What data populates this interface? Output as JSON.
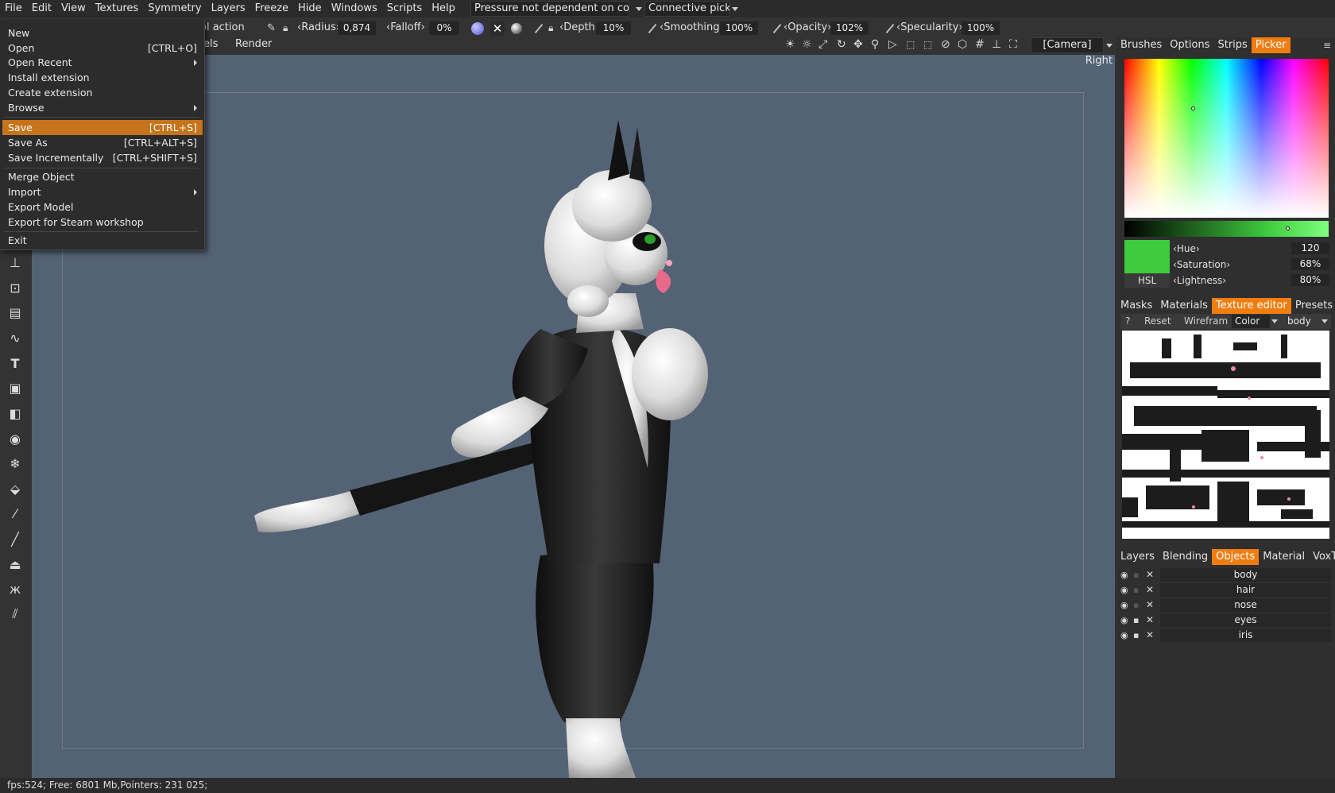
{
  "menubar": {
    "items": [
      "File",
      "Edit",
      "View",
      "Textures",
      "Symmetry",
      "Layers",
      "Freeze",
      "Hide",
      "Windows",
      "Scripts",
      "Help"
    ],
    "pressure_combo": "Pressure not dependent on colo",
    "connective_combo": "Connective picki"
  },
  "toolbar": {
    "tool_action": "ol action",
    "radius_label": "Radius",
    "radius_value": "0,874",
    "falloff_label": "Falloff",
    "falloff_value": "0%",
    "depth_label": "Depth",
    "depth_value": "10%",
    "smoothing_label": "Smoothing",
    "smoothing_value": "100%",
    "opacity_label": "Opacity",
    "opacity_value": "102%",
    "specularity_label": "Specularity",
    "specularity_value": "100%"
  },
  "row3": {
    "els_label": "els",
    "render_label": "Render",
    "camera_combo": "[Camera]"
  },
  "viewport": {
    "view_label": "Right"
  },
  "file_menu": {
    "items": [
      {
        "label": "New",
        "shortcut": ""
      },
      {
        "label": "Open",
        "shortcut": "[CTRL+O]"
      },
      {
        "label": "Open Recent",
        "shortcut": ""
      },
      {
        "label": "Install extension",
        "shortcut": ""
      },
      {
        "label": "Create extension",
        "shortcut": ""
      },
      {
        "label": "Browse",
        "shortcut": ""
      },
      {
        "label": "Save",
        "shortcut": "[CTRL+S]"
      },
      {
        "label": "Save As",
        "shortcut": "[CTRL+ALT+S]"
      },
      {
        "label": "Save Incrementally",
        "shortcut": "[CTRL+SHIFT+S]"
      },
      {
        "label": "Merge Object",
        "shortcut": ""
      },
      {
        "label": "Import",
        "shortcut": ""
      },
      {
        "label": "Export Model",
        "shortcut": ""
      },
      {
        "label": "Export for Steam workshop",
        "shortcut": ""
      },
      {
        "label": "Exit",
        "shortcut": ""
      }
    ]
  },
  "right_panel": {
    "top_tabs": [
      "Brushes",
      "Options",
      "Strips",
      "Picker"
    ],
    "active_top_tab": "Picker",
    "hsl": {
      "mode_label": "HSL",
      "hue_label": "Hue",
      "hue_value": "120",
      "saturation_label": "Saturation",
      "saturation_value": "68%",
      "lightness_label": "Lightness",
      "lightness_value": "80%",
      "swatch_color": "#3ecb3e"
    },
    "mid_tabs": [
      "Masks",
      "Materials",
      "Texture editor",
      "Presets"
    ],
    "active_mid_tab": "Texture editor",
    "texture_toolbar": {
      "help": "?",
      "reset": "Reset",
      "wireframe": "Wirefram",
      "color_combo": "Color",
      "object_combo": "body"
    },
    "bottom_tabs": [
      "Layers",
      "Blending",
      "Objects",
      "Material",
      "VoxTree"
    ],
    "active_bottom_tab": "Objects",
    "objects": [
      "body",
      "hair",
      "nose",
      "eyes",
      "iris"
    ]
  },
  "status_bar": {
    "text": "fps:524;   Free: 6801 Mb,Pointers: 231 025;"
  },
  "colors": {
    "accent": "#f07d10",
    "menu_highlight": "#c6741c",
    "viewport_bg": "#546275"
  }
}
